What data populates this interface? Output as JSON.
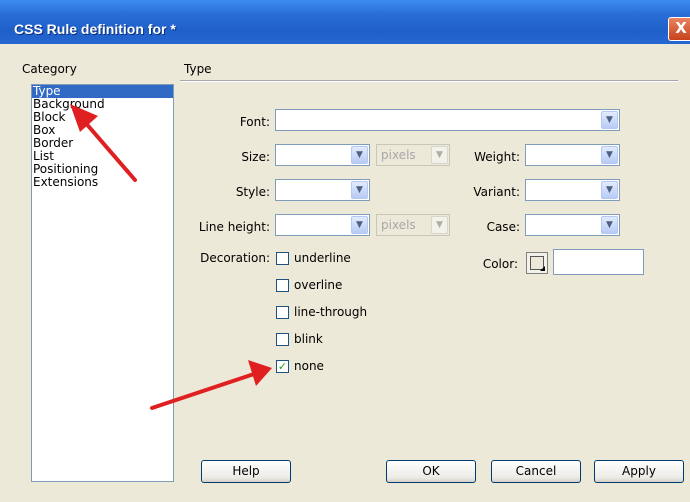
{
  "window": {
    "title": "CSS Rule definition for *",
    "close_glyph": "X"
  },
  "category": {
    "label": "Category",
    "items": [
      {
        "label": "Type",
        "selected": true
      },
      {
        "label": "Background",
        "selected": false
      },
      {
        "label": "Block",
        "selected": false
      },
      {
        "label": "Box",
        "selected": false
      },
      {
        "label": "Border",
        "selected": false
      },
      {
        "label": "List",
        "selected": false
      },
      {
        "label": "Positioning",
        "selected": false
      },
      {
        "label": "Extensions",
        "selected": false
      }
    ]
  },
  "section": {
    "title": "Type"
  },
  "form": {
    "font_label": "Font:",
    "font_value": "",
    "size_label": "Size:",
    "size_value": "",
    "size_unit": "pixels",
    "weight_label": "Weight:",
    "weight_value": "",
    "style_label": "Style:",
    "style_value": "",
    "variant_label": "Variant:",
    "variant_value": "",
    "lineheight_label": "Line height:",
    "lineheight_value": "",
    "lineheight_unit": "pixels",
    "case_label": "Case:",
    "case_value": "",
    "decoration_label": "Decoration:",
    "decorations": [
      {
        "label": "underline",
        "checked": false
      },
      {
        "label": "overline",
        "checked": false
      },
      {
        "label": "line-through",
        "checked": false
      },
      {
        "label": "blink",
        "checked": false
      },
      {
        "label": "none",
        "checked": true
      }
    ],
    "color_label": "Color:",
    "color_value": ""
  },
  "buttons": {
    "help": "Help",
    "ok": "OK",
    "cancel": "Cancel",
    "apply": "Apply"
  },
  "icons": {
    "dropdown": "▼",
    "check": "✓"
  },
  "colors": {
    "titlebar": "#2a6fd8",
    "selection": "#316ac5",
    "arrow": "#e02020",
    "dialog_bg": "#ece9d8"
  }
}
